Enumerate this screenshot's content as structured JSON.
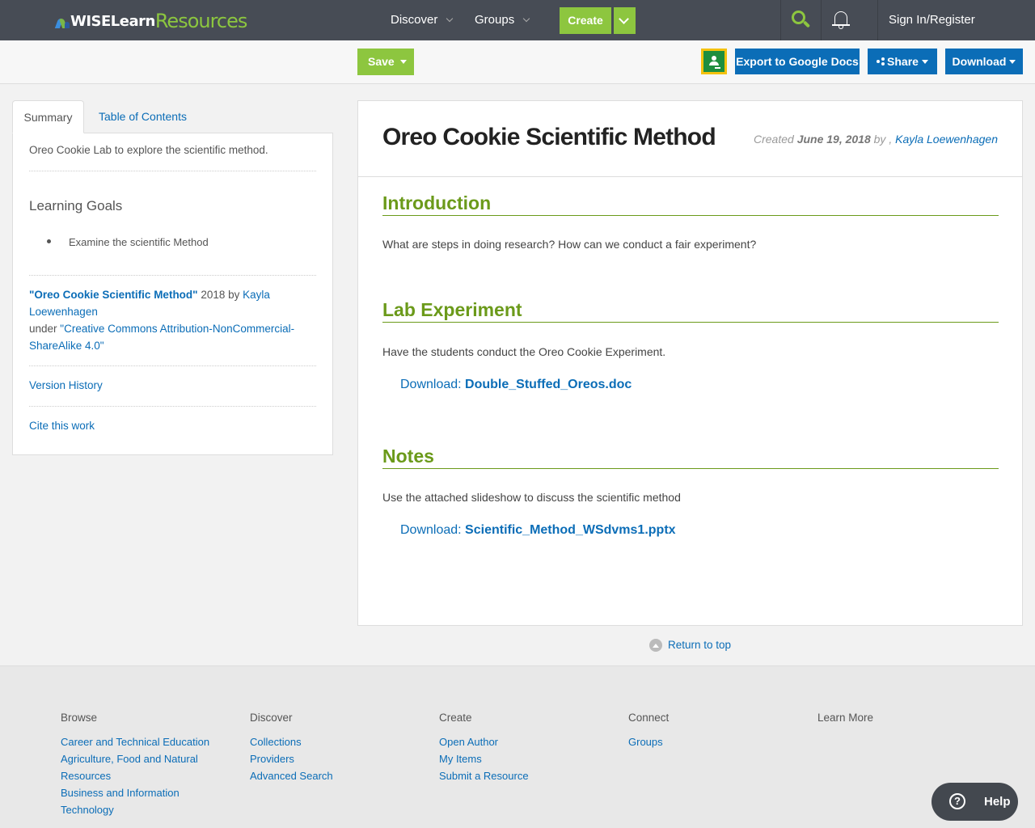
{
  "header": {
    "logo_wise": "WISELearn",
    "logo_resources": "Resources",
    "nav": {
      "discover": "Discover",
      "groups": "Groups",
      "create": "Create",
      "signin": "Sign In/Register"
    }
  },
  "toolbar": {
    "save": "Save",
    "export": "Export to Google Docs",
    "share": "Share",
    "download": "Download"
  },
  "sidebar": {
    "tabs": [
      "Summary",
      "Table of Contents"
    ],
    "summary": "Oreo Cookie Lab to explore the scientific method.",
    "learning_goals_heading": "Learning Goals",
    "goals": [
      "Examine the scientific Method"
    ],
    "attribution": {
      "title": "\"Oreo Cookie Scientific Method\"",
      "year_by": " 2018 by ",
      "author": "Kayla Loewenhagen",
      "under": "under ",
      "license": "\"Creative Commons Attribution-NonCommercial-ShareAlike 4.0\""
    },
    "version_history": "Version History",
    "cite": "Cite this work"
  },
  "main": {
    "title": "Oreo Cookie Scientific Method",
    "meta_created": "Created ",
    "meta_date": "June 19, 2018",
    "meta_by": " by , ",
    "meta_author": "Kayla Loewenhagen",
    "sections": [
      {
        "heading": "Introduction",
        "text": "What are steps in doing research? How can we conduct a fair experiment?"
      },
      {
        "heading": "Lab Experiment",
        "text": "Have the students conduct the Oreo Cookie Experiment.",
        "download_label": "Download: ",
        "download_file": "Double_Stuffed_Oreos.doc"
      },
      {
        "heading": "Notes",
        "text": "Use the attached slideshow to discuss the scientific method",
        "download_label": "Download: ",
        "download_file": "Scientific_Method_WSdvms1.pptx"
      }
    ],
    "return_top": "Return to top"
  },
  "footer": {
    "columns": [
      {
        "heading": "Browse",
        "links": [
          "Career and Technical Education",
          "Agriculture, Food and Natural Resources",
          "Business and Information Technology"
        ]
      },
      {
        "heading": "Discover",
        "links": [
          "Collections",
          "Providers",
          "Advanced Search"
        ]
      },
      {
        "heading": "Create",
        "links": [
          "Open Author",
          "My Items",
          "Submit a Resource"
        ]
      },
      {
        "heading": "Connect",
        "links": [
          "Groups"
        ]
      },
      {
        "heading": "Learn More",
        "links": []
      }
    ]
  },
  "help": "Help",
  "colors": {
    "nav_bg": "#474c55",
    "accent_green": "#8dc63f",
    "link_blue": "#0b6db7",
    "heading_green": "#6b9a1a"
  },
  "icons": [
    "search-icon",
    "bell-icon",
    "google-classroom-icon",
    "share-icon",
    "chevron-down-icon",
    "arrow-up-circle-icon",
    "question-circle-icon"
  ]
}
